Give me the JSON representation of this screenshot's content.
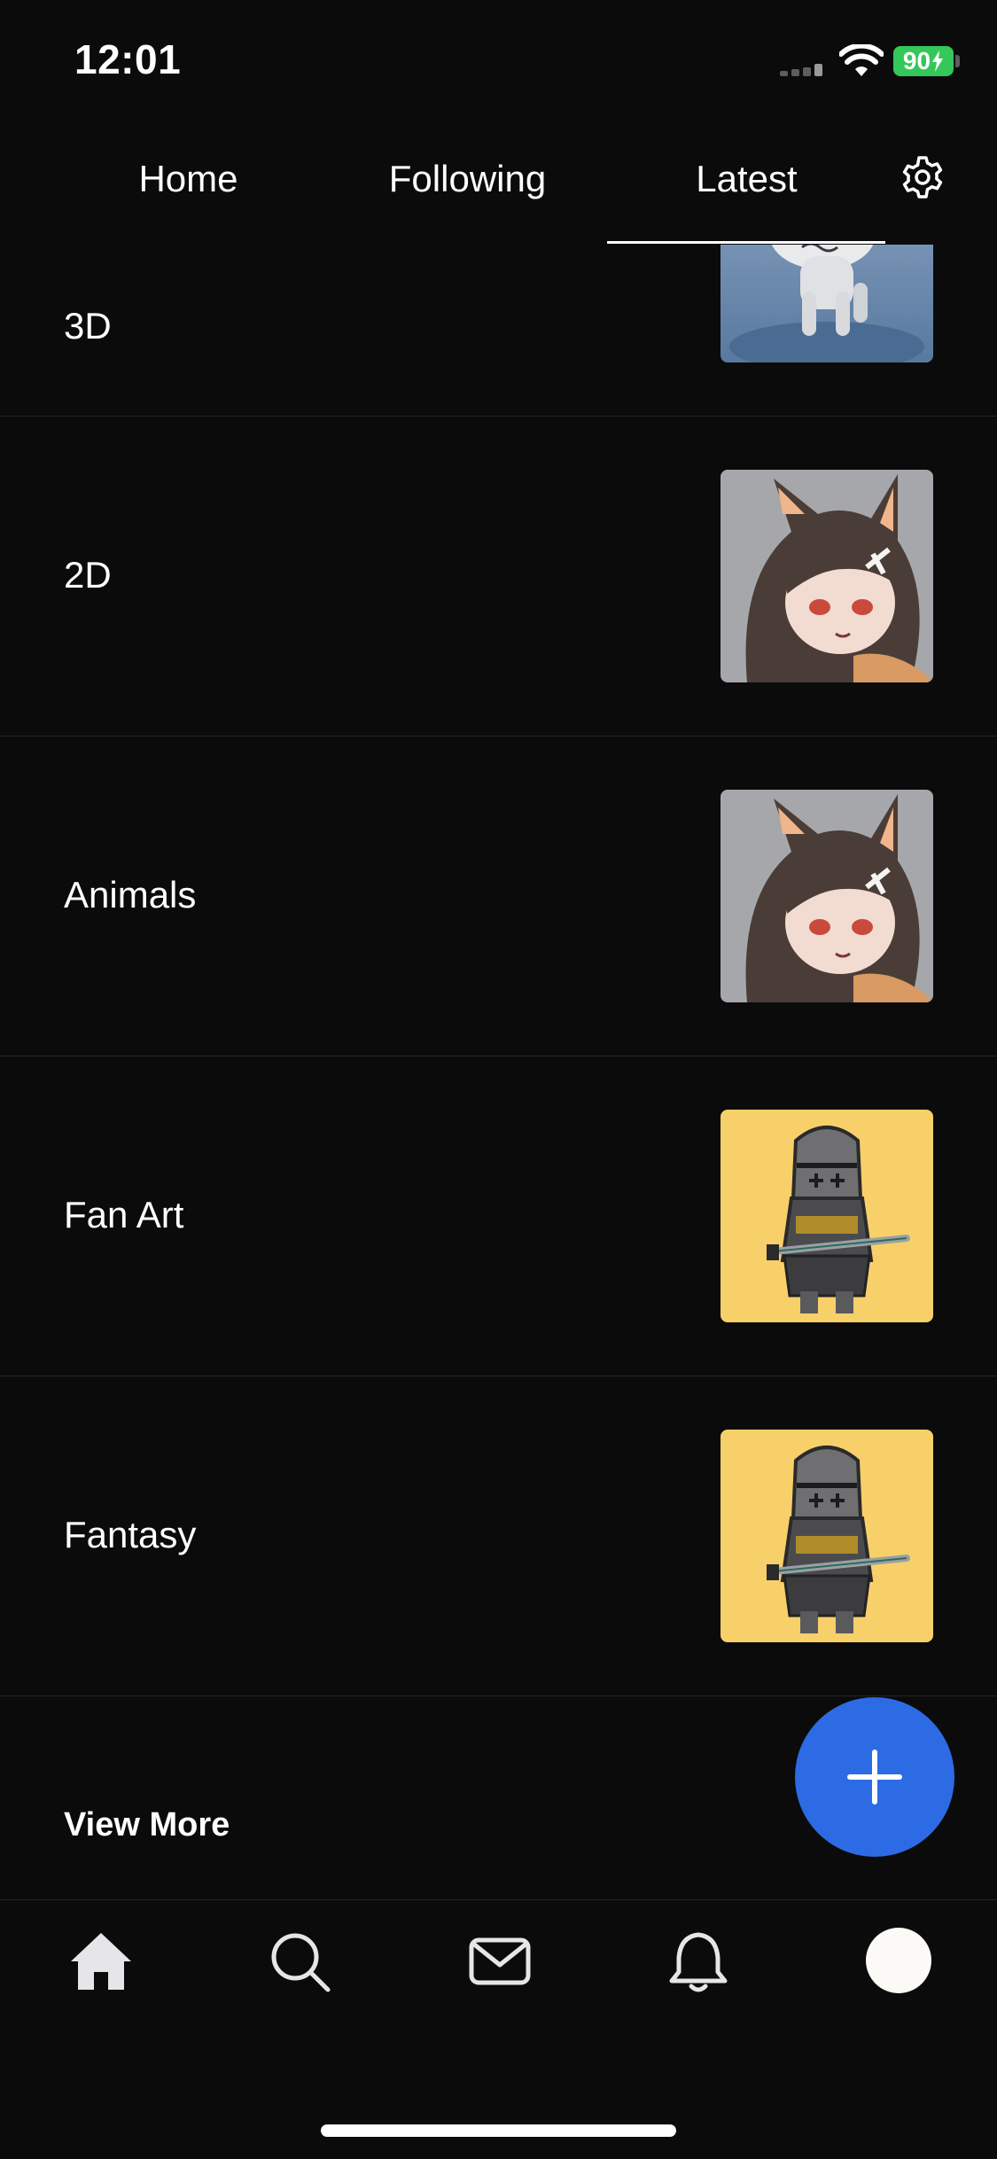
{
  "status_bar": {
    "time": "12:01",
    "battery": "90"
  },
  "top_tabs": {
    "items": [
      "Home",
      "Following",
      "Latest"
    ],
    "selected": "Latest"
  },
  "categories": [
    {
      "label": "3D",
      "thumbnail": "white-3d-creature"
    },
    {
      "label": "2D",
      "thumbnail": "anime-cat-girl"
    },
    {
      "label": "Animals",
      "thumbnail": "anime-cat-girl"
    },
    {
      "label": "Fan Art",
      "thumbnail": "chibi-knight"
    },
    {
      "label": "Fantasy",
      "thumbnail": "chibi-knight"
    }
  ],
  "view_more": "View More",
  "bottom_nav": {
    "items": [
      "home-icon",
      "search-icon",
      "mail-icon",
      "bell-icon",
      "avatar"
    ],
    "active": "home-icon"
  },
  "colors": {
    "background": "#0b0b0c",
    "fab": "#2d6be4",
    "battery": "#34c759",
    "divider": "#26262a"
  }
}
